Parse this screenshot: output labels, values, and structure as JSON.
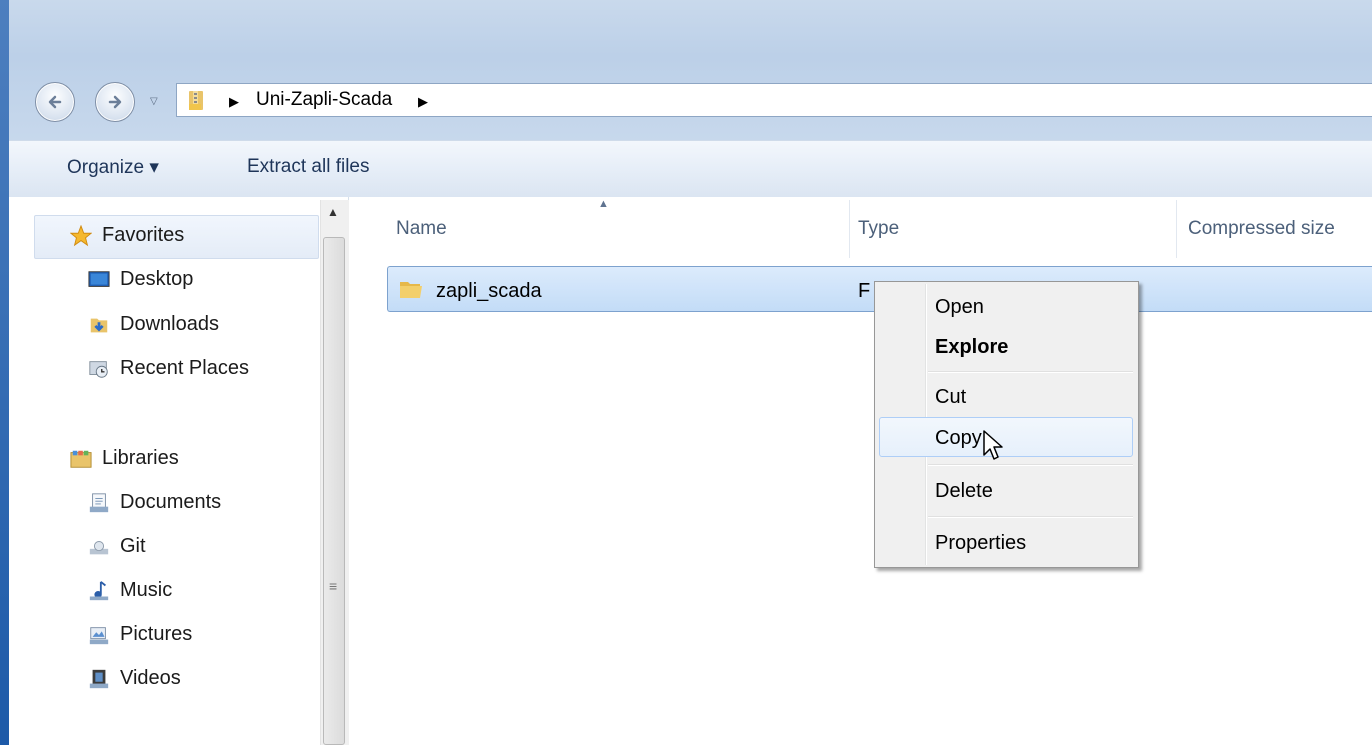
{
  "address_bar": {
    "path": "Uni-Zapli-Scada"
  },
  "command_bar": {
    "organize_label": "Organize ▾",
    "extract_label": "Extract all files"
  },
  "nav_pane": {
    "favorites": {
      "label": "Favorites",
      "items": [
        {
          "label": "Desktop",
          "icon": "desktop-icon"
        },
        {
          "label": "Downloads",
          "icon": "downloads-icon"
        },
        {
          "label": "Recent Places",
          "icon": "recent-places-icon"
        }
      ]
    },
    "libraries": {
      "label": "Libraries",
      "items": [
        {
          "label": "Documents",
          "icon": "documents-icon"
        },
        {
          "label": "Git",
          "icon": "git-icon"
        },
        {
          "label": "Music",
          "icon": "music-icon"
        },
        {
          "label": "Pictures",
          "icon": "pictures-icon"
        },
        {
          "label": "Videos",
          "icon": "videos-icon"
        }
      ]
    }
  },
  "columns": {
    "name": "Name",
    "type": "Type",
    "compressed_size": "Compressed size"
  },
  "files": [
    {
      "name": "zapli_scada",
      "type_partial": "F"
    }
  ],
  "context_menu": {
    "items": [
      "Open",
      "Explore",
      "Cut",
      "Copy",
      "Delete",
      "Properties"
    ],
    "default_item": "Explore",
    "hovered_item": "Copy"
  },
  "colors": {
    "accent": "#3b6fb6",
    "selection": "#cce4fb",
    "menu_bg": "#f0f0f0"
  }
}
